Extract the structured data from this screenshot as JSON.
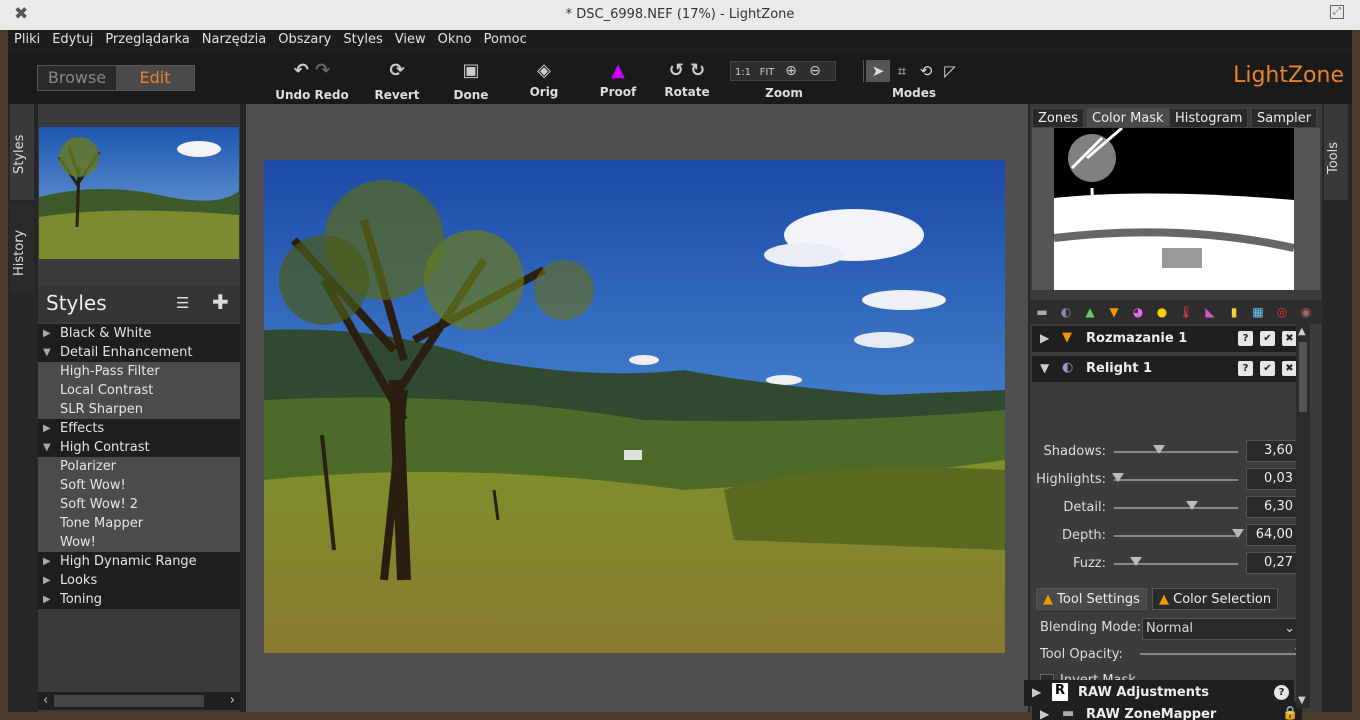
{
  "window": {
    "title": "* DSC_6998.NEF (17%) - LightZone"
  },
  "menu": [
    "Pliki",
    "Edytuj",
    "Przeglądarka",
    "Narzędzia",
    "Obszary",
    "Styles",
    "View",
    "Okno",
    "Pomoc"
  ],
  "toolbar": {
    "browse": "Browse",
    "edit": "Edit",
    "undo_redo": "Undo Redo",
    "revert": "Revert",
    "done": "Done",
    "orig": "Orig",
    "proof": "Proof",
    "rotate": "Rotate",
    "zoom": "Zoom",
    "zoom_1to1": "1:1",
    "zoom_fit": "FIT",
    "modes": "Modes",
    "logo": "LightZone"
  },
  "left_tabs": {
    "styles": "Styles",
    "history": "History"
  },
  "right_tab": "Tools",
  "styles_panel": {
    "title": "Styles",
    "items": [
      {
        "label": "Black & White",
        "type": "cat",
        "open": false
      },
      {
        "label": "Detail Enhancement",
        "type": "cat",
        "open": true
      },
      {
        "label": "High-Pass Filter",
        "type": "item"
      },
      {
        "label": "Local Contrast",
        "type": "item"
      },
      {
        "label": "SLR Sharpen",
        "type": "item"
      },
      {
        "label": "Effects",
        "type": "cat",
        "open": false
      },
      {
        "label": "High Contrast",
        "type": "cat",
        "open": true
      },
      {
        "label": "Polarizer",
        "type": "item"
      },
      {
        "label": "Soft Wow!",
        "type": "item"
      },
      {
        "label": "Soft Wow! 2",
        "type": "item"
      },
      {
        "label": "Tone Mapper",
        "type": "item"
      },
      {
        "label": "Wow!",
        "type": "item"
      },
      {
        "label": "High Dynamic Range",
        "type": "cat",
        "open": false
      },
      {
        "label": "Looks",
        "type": "cat",
        "open": false
      },
      {
        "label": "Toning",
        "type": "cat",
        "open": false
      }
    ]
  },
  "right_panel": {
    "tabs": [
      "Zones",
      "Color Mask",
      "Histogram",
      "Sampler"
    ],
    "active_tab": "Color Mask",
    "tool1": {
      "name": "Rozmazanie 1"
    },
    "tool2": {
      "name": "Relight 1"
    },
    "sliders": [
      {
        "label": "Shadows:",
        "value": "3,60",
        "pos": 0.36
      },
      {
        "label": "Highlights:",
        "value": "0,03",
        "pos": 0.03
      },
      {
        "label": "Detail:",
        "value": "6,30",
        "pos": 0.63
      },
      {
        "label": "Depth:",
        "value": "64,00",
        "pos": 1.0
      },
      {
        "label": "Fuzz:",
        "value": "0,27",
        "pos": 0.18
      }
    ],
    "subtabs": [
      "Tool Settings",
      "Color Selection"
    ],
    "blending_label": "Blending Mode:",
    "blending_value": "Normal",
    "opacity_label": "Tool Opacity:",
    "opacity_value": 1.0,
    "invert_label": "Invert Mask",
    "tool3": {
      "name": "RAW ZoneMapper"
    },
    "tool4": {
      "name": "RAW Adjustments"
    }
  },
  "colors": {
    "accent": "#e8842a",
    "panel": "#3c3c3c"
  }
}
